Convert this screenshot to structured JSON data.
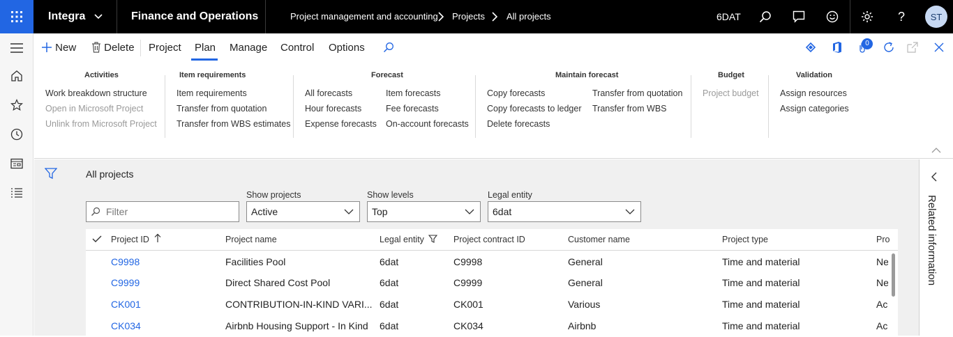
{
  "topbar": {
    "company": "Integra",
    "app_title": "Finance and Operations",
    "breadcrumb": [
      "Project management and accounting",
      "Projects",
      "All projects"
    ],
    "legal_entity_badge": "6DAT",
    "user_initials": "ST"
  },
  "actionbar": {
    "new_label": "New",
    "delete_label": "Delete",
    "tabs": [
      "Project",
      "Plan",
      "Manage",
      "Control",
      "Options"
    ],
    "active_tab": "Plan",
    "notification_count": "0"
  },
  "ribbon": {
    "groups": [
      {
        "title": "Activities",
        "items": [
          "Work breakdown structure",
          "Open in Microsoft Project",
          "Unlink from Microsoft Project"
        ]
      },
      {
        "title": "Item requirements",
        "items": [
          "Item requirements",
          "Transfer from quotation",
          "Transfer from WBS estimates"
        ]
      },
      {
        "title": "Forecast",
        "items": [
          "All forecasts",
          "Hour forecasts",
          "Expense forecasts",
          "Item forecasts",
          "Fee forecasts",
          "On-account forecasts"
        ]
      },
      {
        "title": "Maintain forecast",
        "items": [
          "Copy forecasts",
          "Copy forecasts to ledger",
          "Delete forecasts",
          "Transfer from quotation",
          "Transfer from WBS"
        ]
      },
      {
        "title": "Budget",
        "items": [
          "Project budget"
        ]
      },
      {
        "title": "Validation",
        "items": [
          "Assign resources",
          "Assign categories"
        ]
      }
    ]
  },
  "page": {
    "title": "All projects",
    "filter_placeholder": "Filter",
    "show_projects_label": "Show projects",
    "show_projects_value": "Active",
    "show_levels_label": "Show levels",
    "show_levels_value": "Top",
    "legal_entity_label": "Legal entity",
    "legal_entity_value": "6dat"
  },
  "grid": {
    "columns": [
      "Project ID",
      "Project name",
      "Legal entity",
      "Project contract ID",
      "Customer name",
      "Project type",
      "Pro"
    ],
    "rows": [
      [
        "C9998",
        "Facilities Pool",
        "6dat",
        "C9998",
        "General",
        "Time and material",
        "Ne"
      ],
      [
        "C9999",
        "Direct Shared Cost Pool",
        "6dat",
        "C9999",
        "General",
        "Time and material",
        "Ne"
      ],
      [
        "CK001",
        "CONTRIBUTION-IN-KIND  VARI...",
        "6dat",
        "CK001",
        "Various",
        "Time and material",
        "Ac"
      ],
      [
        "CK034",
        "Airbnb Housing Support - In Kind",
        "6dat",
        "CK034",
        "Airbnb",
        "Time and material",
        "Ac"
      ]
    ]
  },
  "related_info_label": "Related information",
  "colors": {
    "accent": "#2266e3",
    "topbar": "#000000"
  }
}
